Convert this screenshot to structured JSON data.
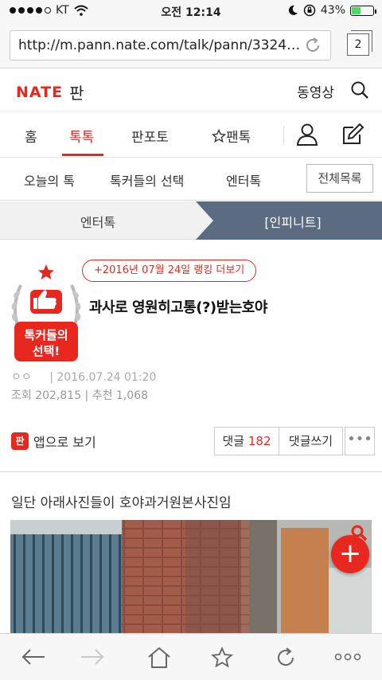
{
  "status_bar": {
    "carrier": "KT",
    "time": "오전 12:14",
    "battery": "43%",
    "battery_level": 0.43
  },
  "browser": {
    "url": "http://m.pann.nate.com/talk/pann/3324…",
    "tab_count": "2"
  },
  "header": {
    "logo": "NATE",
    "logo_sub": "판",
    "video_label": "동영상"
  },
  "main_nav": {
    "items": [
      "홈",
      "톡톡",
      "판포토",
      "팬톡"
    ],
    "active": "톡톡"
  },
  "sub_nav": {
    "items": [
      "오늘의 톡",
      "톡커들의 선택",
      "엔터톡"
    ],
    "all_list": "전체목록"
  },
  "category": {
    "left": "엔터톡",
    "right": "[인피니트]"
  },
  "article": {
    "badge_text": [
      "톡커들의",
      "선택!"
    ],
    "rank_link": "+2016년 07월 24일 랭킹 더보기",
    "title": "과사로 영원히고통(?)받는호야",
    "author": "ㅇㅇ",
    "date": "2016.07.24 01:20",
    "stats": "조회 202,815 | 추천 1,068",
    "app_view": "앱으로 보기",
    "app_icon": "판",
    "comments_label": "댓글",
    "comments_count": "182",
    "write_comment": "댓글쓰기",
    "more": "•••",
    "body_line": "일단 아래사진들이 호야과거원본사진임"
  },
  "colors": {
    "brand": "#e8271e",
    "nav_dark": "#5a6b82"
  }
}
